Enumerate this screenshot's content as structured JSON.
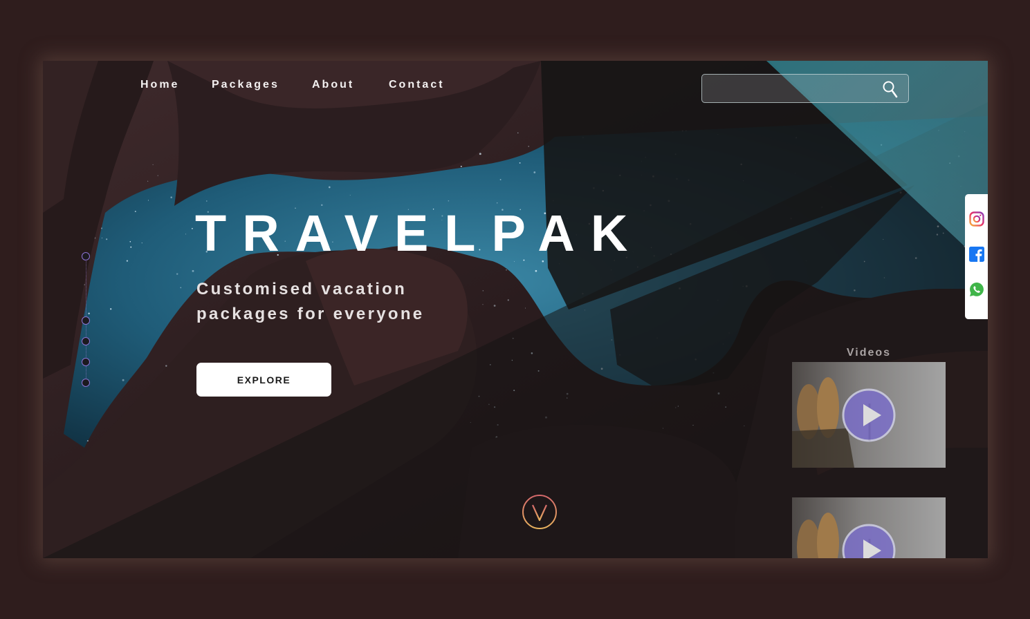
{
  "nav": {
    "items": [
      {
        "label": "Home"
      },
      {
        "label": "Packages"
      },
      {
        "label": "About"
      },
      {
        "label": "Contact"
      }
    ]
  },
  "search": {
    "value": "",
    "placeholder": "",
    "icon": "search-icon"
  },
  "hero": {
    "title": "TRAVELPAK",
    "tagline_line1": "Customised vacation",
    "tagline_line2": "packages for everyone",
    "cta_label": "EXPLORE"
  },
  "slides": {
    "count": 5,
    "active_index": 0
  },
  "social": {
    "icons": [
      "instagram-icon",
      "facebook-icon",
      "whatsapp-icon"
    ]
  },
  "videos": {
    "title": "Videos",
    "items": [
      {
        "icon": "play-icon"
      },
      {
        "icon": "play-icon"
      }
    ]
  },
  "scroll": {
    "icon": "chevron-down-icon"
  },
  "colors": {
    "background": "#2f1d1d",
    "accent_purple": "#7b6fc9",
    "accent_orange": "#e0a35f",
    "sky_blue": "#2a7898"
  }
}
